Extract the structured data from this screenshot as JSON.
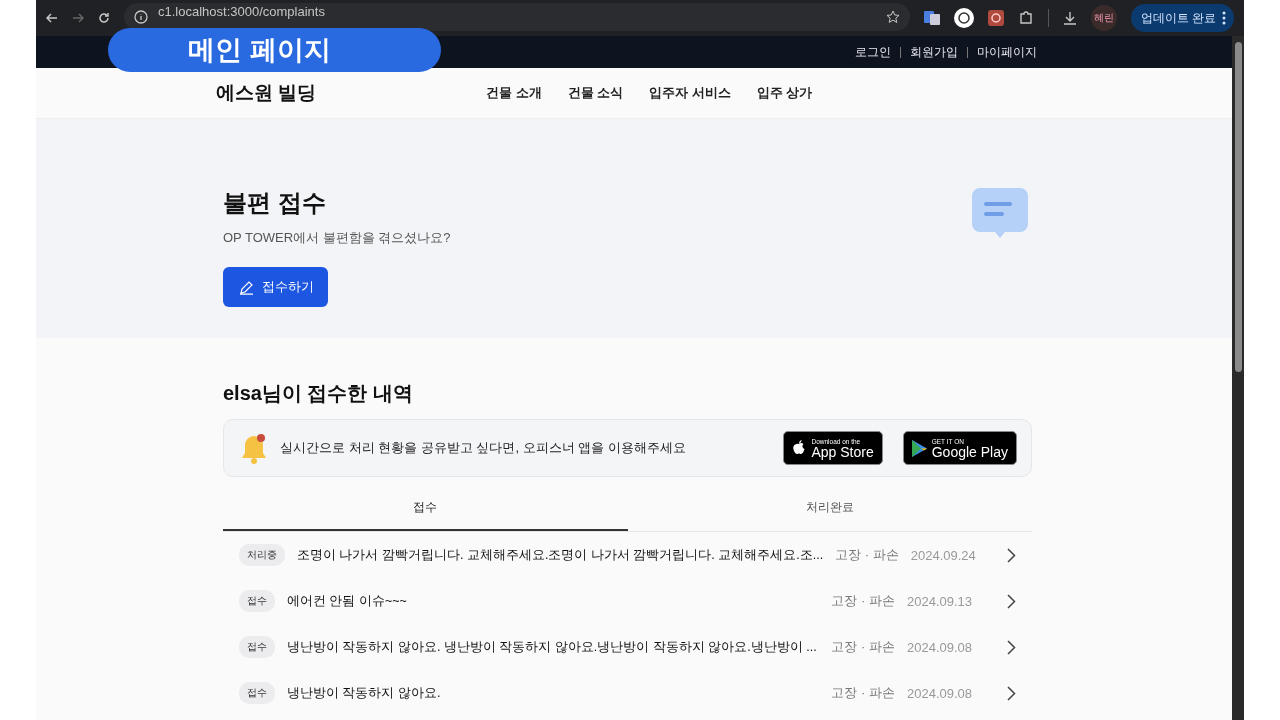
{
  "browser": {
    "url": "c1.localhost:3000/complaints",
    "profile": "혜린",
    "update_button": "업데이트 완료"
  },
  "overlay_label": "메인 페이지",
  "utility_links": [
    "로그인",
    "회원가입",
    "마이페이지"
  ],
  "header": {
    "logo": "에스원 빌딩",
    "nav": [
      "건물 소개",
      "건물 소식",
      "입주자 서비스",
      "입주 상가"
    ]
  },
  "hero": {
    "title": "불편 접수",
    "subtitle": "OP TOWER에서 불편함을 겪으셨나요?",
    "button": "접수하기"
  },
  "history": {
    "title": "elsa님이 접수한 내역",
    "banner": {
      "text": "실시간으로 처리 현황을 공유받고 싶다면, 오피스너 앱을 이용해주세요",
      "app_store": {
        "small": "Download on the",
        "big": "App Store"
      },
      "google_play": {
        "small": "GET IT ON",
        "big": "Google Play"
      }
    },
    "tabs": [
      {
        "label": "접수",
        "selected": true
      },
      {
        "label": "처리완료",
        "selected": false
      }
    ],
    "rows": [
      {
        "status": "처리중",
        "title": "조명이 나가서 깜빡거립니다. 교체해주세요.조명이 나가서 깜빡거립니다. 교체해주세요.조...",
        "category": "고장 · 파손",
        "date": "2024.09.24"
      },
      {
        "status": "접수",
        "title": "에어컨 안됨 이슈~~~",
        "category": "고장 · 파손",
        "date": "2024.09.13"
      },
      {
        "status": "접수",
        "title": "냉난방이 작동하지 않아요. 냉난방이 작동하지 않아요.냉난방이 작동하지 않아요.냉난방이 ...",
        "category": "고장 · 파손",
        "date": "2024.09.08"
      },
      {
        "status": "접수",
        "title": "냉난방이 작동하지 않아요.",
        "category": "고장 · 파손",
        "date": "2024.09.08"
      }
    ]
  }
}
